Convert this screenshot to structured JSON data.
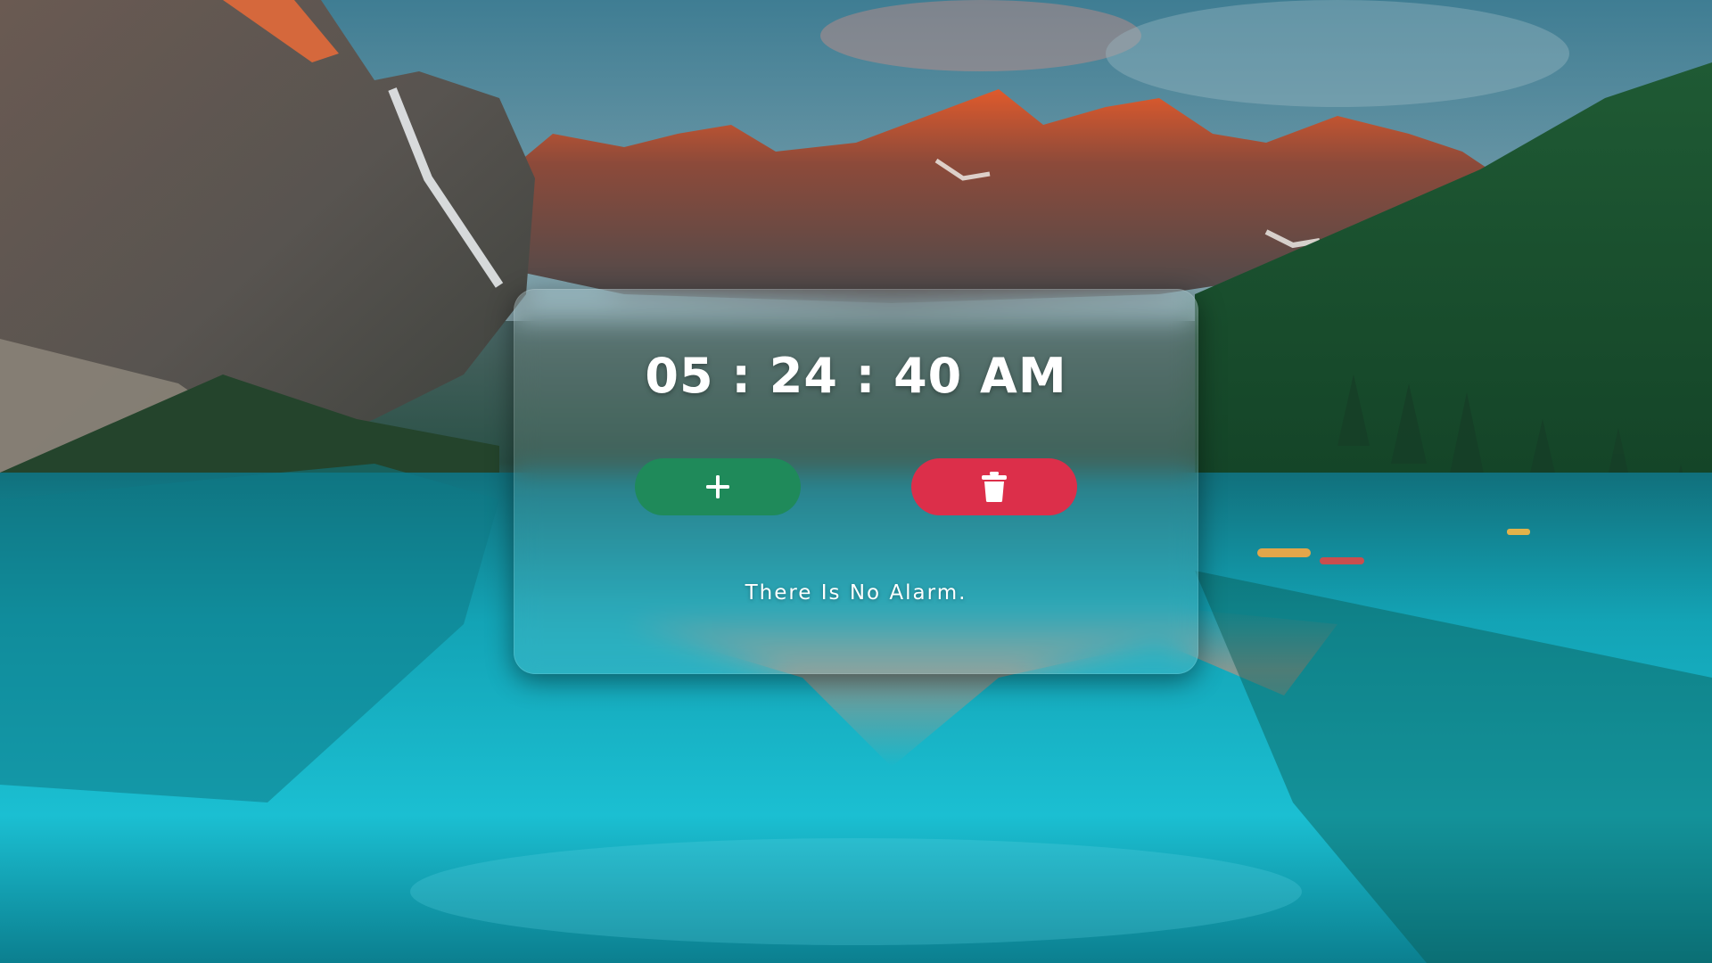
{
  "clock": {
    "time": "05 : 24 : 40 AM"
  },
  "buttons": {
    "add_icon": "plus-icon",
    "delete_icon": "trash-icon",
    "add_color": "#1f8a5a",
    "delete_color": "#dc2f4a"
  },
  "alarm_list": {
    "empty_message": "There Is No Alarm."
  },
  "background": {
    "scene": "mountain-lake-landscape"
  }
}
